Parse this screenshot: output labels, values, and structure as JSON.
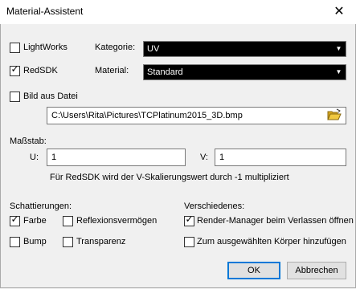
{
  "window": {
    "title": "Material-Assistent"
  },
  "options": {
    "lightworks": {
      "label": "LightWorks",
      "checked": false
    },
    "redsdk": {
      "label": "RedSDK",
      "checked": true
    },
    "bild": {
      "label": "Bild aus Datei",
      "checked": false
    }
  },
  "kategorie": {
    "label": "Kategorie:",
    "value": "UV"
  },
  "material": {
    "label": "Material:",
    "value": "Standard"
  },
  "file": {
    "path": "C:\\Users\\Rita\\Pictures\\TCPlatinum2015_3D.bmp"
  },
  "scale": {
    "title": "Maßstab:",
    "u_label": "U:",
    "u_value": "1",
    "v_label": "V:",
    "v_value": "1",
    "note": "Für RedSDK wird der V-Skalierungswert durch -1 multipliziert"
  },
  "shading": {
    "title": "Schattierungen:",
    "farbe": {
      "label": "Farbe",
      "checked": true
    },
    "bump": {
      "label": "Bump",
      "checked": false
    },
    "reflexion": {
      "label": "Reflexionsvermögen",
      "checked": false
    },
    "transparenz": {
      "label": "Transparenz",
      "checked": false
    }
  },
  "misc": {
    "title": "Verschiedenes:",
    "render": {
      "label": "Render-Manager beim Verlassen öffnen",
      "checked": true
    },
    "body": {
      "label": "Zum ausgewählten Körper hinzufügen",
      "checked": false
    }
  },
  "buttons": {
    "ok": "OK",
    "cancel": "Abbrechen"
  },
  "colors": {
    "select_bg": "#000000",
    "folder": "#e8b820"
  }
}
